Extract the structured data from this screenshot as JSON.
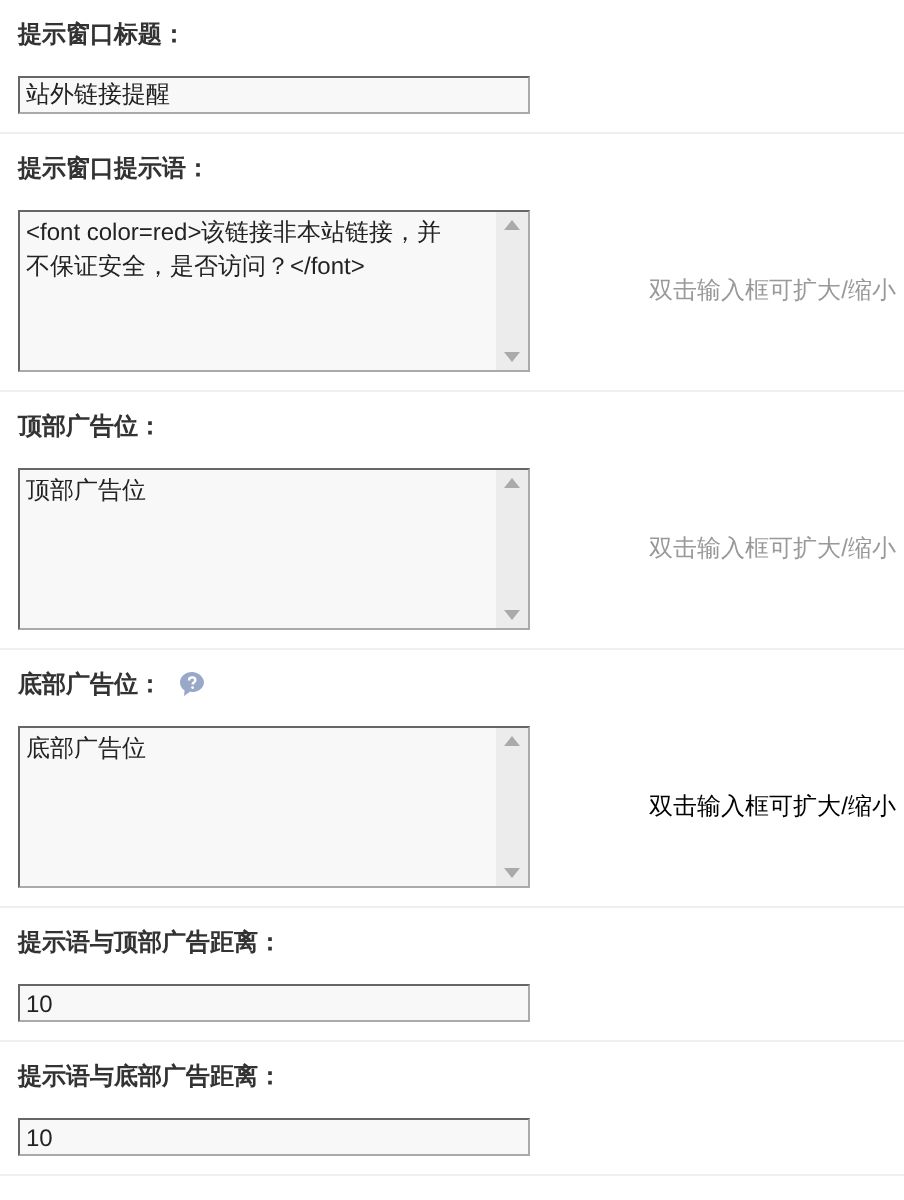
{
  "settings": [
    {
      "label": "提示窗口标题：",
      "help_icon": false,
      "field": {
        "kind": "input",
        "value": "站外链接提醒"
      }
    },
    {
      "label": "提示窗口提示语：",
      "help_icon": false,
      "field": {
        "kind": "textarea",
        "value": "<font color=red>该链接非本站链接，并不保证安全，是否访问？</font>"
      },
      "hint": {
        "text": "双击输入框可扩大/缩小",
        "highlighted": false
      }
    },
    {
      "label": "顶部广告位：",
      "help_icon": false,
      "field": {
        "kind": "textarea",
        "value": "顶部广告位"
      },
      "hint": {
        "text": "双击输入框可扩大/缩小",
        "highlighted": false
      }
    },
    {
      "label": "底部广告位：",
      "help_icon": true,
      "field": {
        "kind": "textarea",
        "value": "底部广告位"
      },
      "hint": {
        "text": "双击输入框可扩大/缩小",
        "highlighted": true
      }
    },
    {
      "label": "提示语与顶部广告距离：",
      "help_icon": false,
      "field": {
        "kind": "input",
        "value": "10"
      }
    },
    {
      "label": "提示语与底部广告距离：",
      "help_icon": false,
      "field": {
        "kind": "input",
        "value": "10"
      }
    }
  ]
}
